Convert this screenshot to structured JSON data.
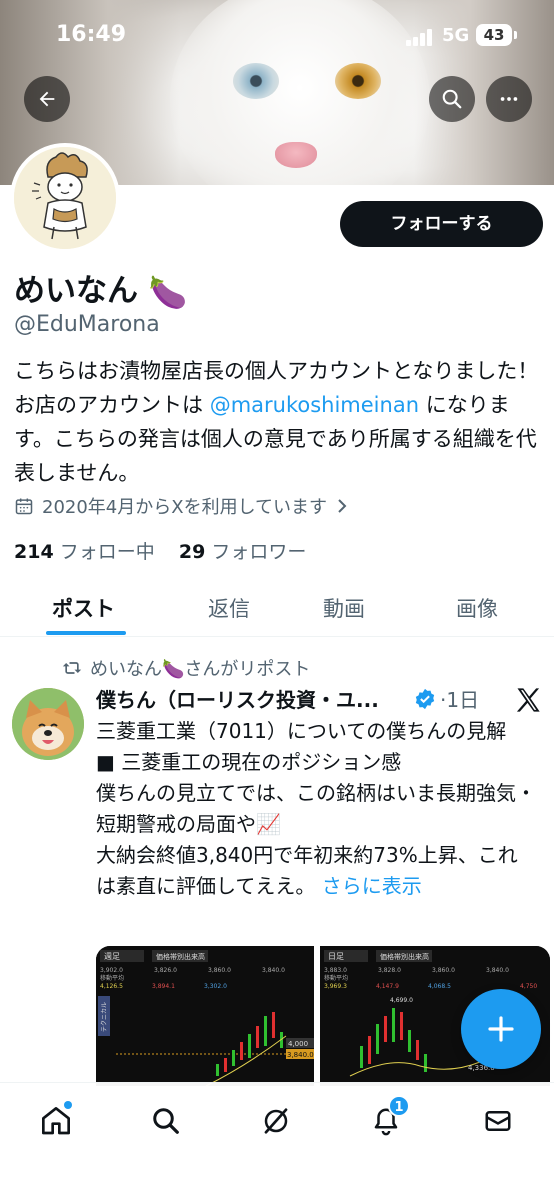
{
  "status_bar": {
    "time": "16:49",
    "network": "5G",
    "battery": "43"
  },
  "header": {
    "back_icon": "back-arrow-icon",
    "search_icon": "search-icon",
    "more_icon": "more-icon"
  },
  "profile": {
    "follow_label": "フォローする",
    "display_name": "めいなん",
    "name_emoji": "🍆",
    "handle": "@EduMarona",
    "bio_before": "こちらはお漬物屋店長の個人アカウントとなりました！ お店のアカウントは ",
    "bio_mention": "@marukoshimeinan",
    "bio_after": " になります。こちらの発言は個人の意見であり所属する組織を代表しません。",
    "joined": "2020年4月からXを利用しています",
    "following_count": "214",
    "following_label": "フォロー中",
    "followers_count": "29",
    "followers_label": "フォロワー"
  },
  "tabs": [
    {
      "label": "ポスト",
      "active": true
    },
    {
      "label": "返信",
      "active": false
    },
    {
      "label": "動画",
      "active": false
    },
    {
      "label": "画像",
      "active": false
    }
  ],
  "tweet": {
    "repost_label": "めいなん🍆さんがリポスト",
    "author_name": "僕ちん（ローリスク投資・ユ...",
    "time": "1日",
    "text_lines": [
      "三菱重工業（7011）についての僕ちんの見解",
      "■ 三菱重工の現在のポジション感",
      "僕ちんの見立てでは、この銘柄はいま長期強気・短期警戒の局面や📈",
      "大納会終値3,840円で年初来約73%上昇、これは素直に評価してええ。"
    ],
    "show_more": "さらに表示",
    "chart1": {
      "period": "週足",
      "indicator": "価格帯別出来高",
      "vals": [
        "3,902.0",
        "3,826.0",
        "3,860.0",
        "3,840.0"
      ],
      "ma_label": "移動平均",
      "ma": [
        "4,126.5",
        "3,894.1",
        "3,302.0"
      ],
      "side_label": "テクニカル",
      "price_label_top": "4,000",
      "price_label_current": "3,840.0"
    },
    "chart2": {
      "period": "日足",
      "indicator": "価格帯別出来高",
      "vals": [
        "3,883.0",
        "3,828.0",
        "3,860.0",
        "3,840.0"
      ],
      "ma_label": "移動平均",
      "ma": [
        "3,969.3",
        "4,147.9",
        "4,068.5"
      ],
      "label_peak": "4,699.0",
      "label_low": "4,336.0",
      "label_right": "4,750"
    }
  },
  "bottom_nav": {
    "notifications_badge": "1"
  },
  "colors": {
    "accent": "#1d9bf0",
    "text": "#0f1419",
    "muted": "#536471"
  }
}
